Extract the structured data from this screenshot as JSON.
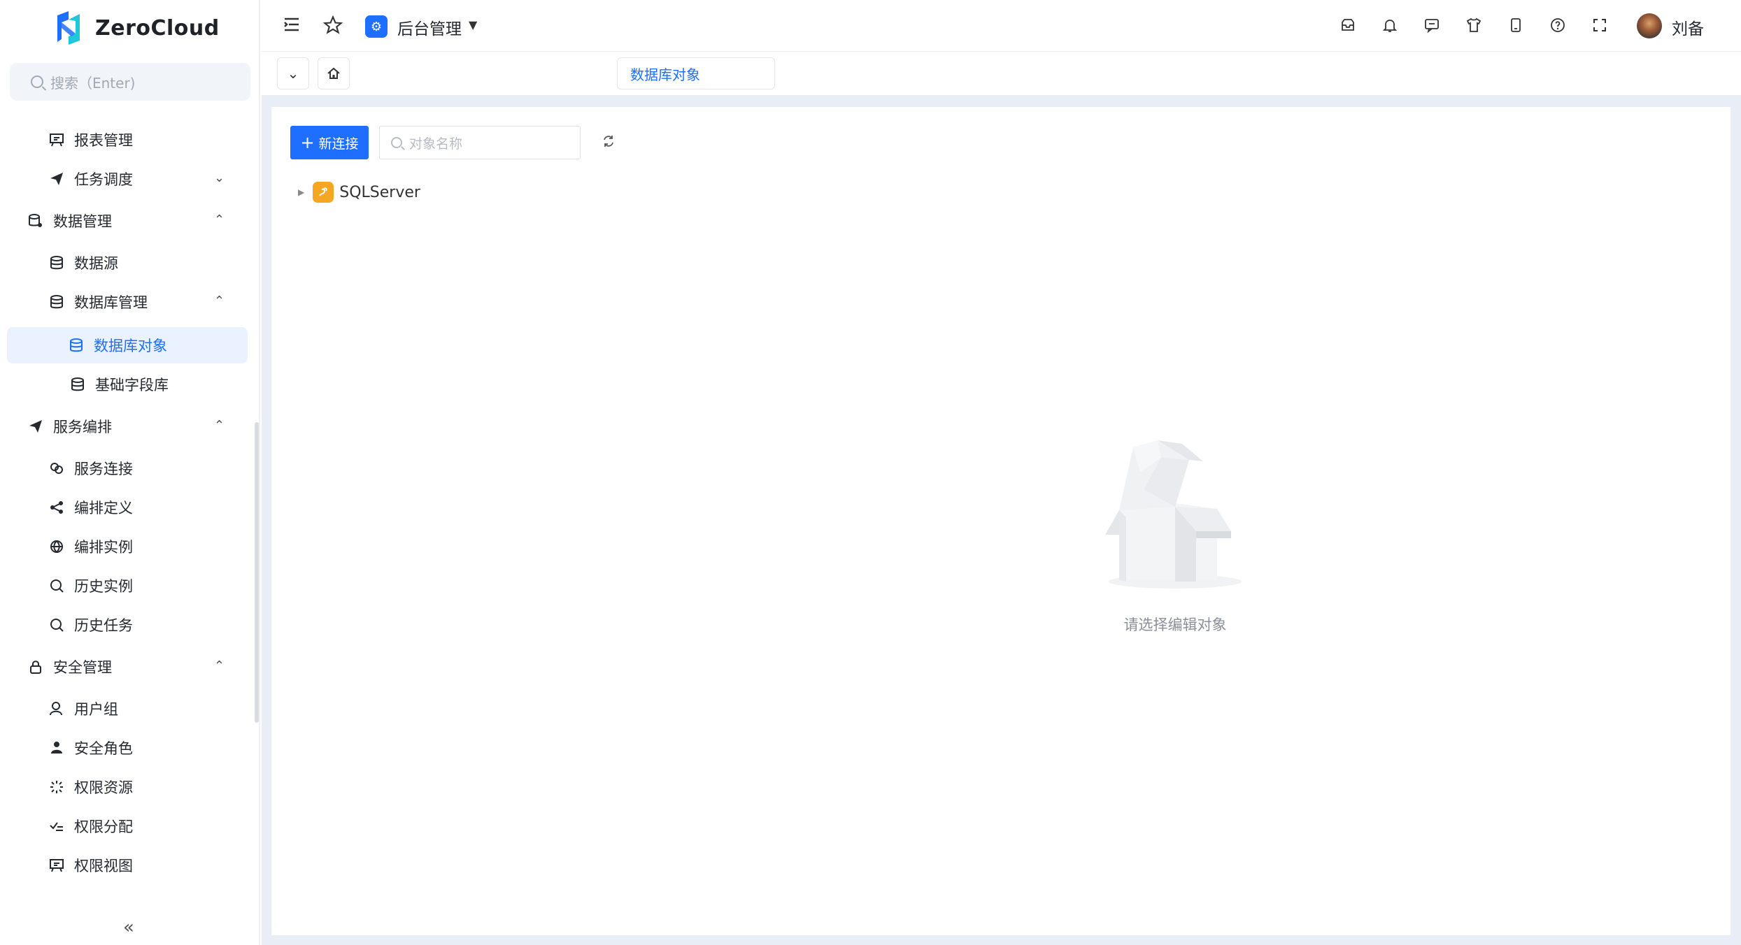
{
  "app": {
    "name": "ZeroCloud"
  },
  "sidebar": {
    "search_placeholder": "搜索（Enter)",
    "items": [
      {
        "label": "报表管理",
        "icon": "presentation-icon",
        "level": 2,
        "expandable": false
      },
      {
        "label": "任务调度",
        "icon": "send-icon",
        "level": 2,
        "expandable": true,
        "expanded": false
      },
      {
        "label": "数据管理",
        "icon": "database-settings-icon",
        "level": 1,
        "expandable": true,
        "expanded": true
      },
      {
        "label": "数据源",
        "icon": "database-icon",
        "level": 2,
        "expandable": false
      },
      {
        "label": "数据库管理",
        "icon": "database-icon",
        "level": 2,
        "expandable": true,
        "expanded": true
      },
      {
        "label": "数据库对象",
        "icon": "database-icon",
        "level": 3,
        "expandable": false,
        "active": true
      },
      {
        "label": "基础字段库",
        "icon": "database-icon",
        "level": 3,
        "expandable": false
      },
      {
        "label": "服务编排",
        "icon": "send-icon",
        "level": 1,
        "expandable": true,
        "expanded": true
      },
      {
        "label": "服务连接",
        "icon": "link-icon",
        "level": 2,
        "expandable": false
      },
      {
        "label": "编排定义",
        "icon": "share-icon",
        "level": 2,
        "expandable": false
      },
      {
        "label": "编排实例",
        "icon": "globe-icon",
        "level": 2,
        "expandable": false
      },
      {
        "label": "历史实例",
        "icon": "search-icon",
        "level": 2,
        "expandable": false
      },
      {
        "label": "历史任务",
        "icon": "search-icon",
        "level": 2,
        "expandable": false
      },
      {
        "label": "安全管理",
        "icon": "lock-icon",
        "level": 1,
        "expandable": true,
        "expanded": true
      },
      {
        "label": "用户组",
        "icon": "user-icon",
        "level": 2,
        "expandable": false
      },
      {
        "label": "安全角色",
        "icon": "user-group-icon",
        "level": 2,
        "expandable": false
      },
      {
        "label": "权限资源",
        "icon": "loader-icon",
        "level": 2,
        "expandable": false
      },
      {
        "label": "权限分配",
        "icon": "checklist-icon",
        "level": 2,
        "expandable": false
      },
      {
        "label": "权限视图",
        "icon": "presentation-icon",
        "level": 2,
        "expandable": false
      }
    ]
  },
  "header": {
    "module_title": "后台管理",
    "username": "刘备",
    "right_icons": [
      "inbox-icon",
      "bell-icon",
      "message-icon",
      "shirt-icon",
      "tablet-icon",
      "help-icon",
      "fullscreen-icon"
    ]
  },
  "tabs": {
    "active_tab": "数据库对象"
  },
  "toolbar": {
    "new_connection_label": "新连接",
    "search_placeholder": "对象名称"
  },
  "tree": {
    "nodes": [
      {
        "label": "SQLServer",
        "expanded": false
      }
    ]
  },
  "empty_state": {
    "message": "请选择编辑对象"
  },
  "colors": {
    "primary": "#1e6fff",
    "active_bg": "#ebf2ff",
    "content_bg": "#e9eef6",
    "sqlserver_icon": "#f5a623"
  }
}
